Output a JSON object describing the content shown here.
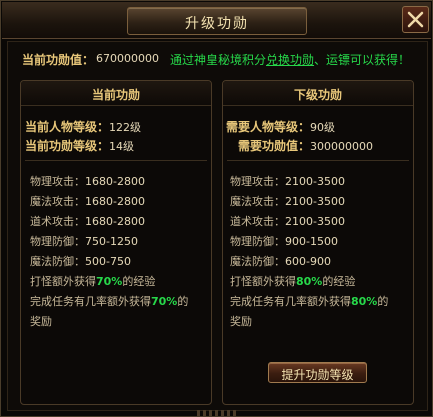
{
  "window": {
    "title": "升级功勋",
    "close_icon": "close-icon"
  },
  "info": {
    "label": "当前功勋值：",
    "value": "670000000",
    "note_prefix": "通过神皇秘境积分",
    "note_link": "兑换功勋",
    "note_suffix": "、运镖可以获得！"
  },
  "current": {
    "header": "当前功勋",
    "char_level_label": "当前人物等级：",
    "char_level_value": "122级",
    "merit_level_label": "当前功勋等级：",
    "merit_level_value": "14级",
    "stats": [
      {
        "label": "物理攻击：",
        "value": "1680-2800"
      },
      {
        "label": "魔法攻击：",
        "value": "1680-2800"
      },
      {
        "label": "道术攻击：",
        "value": "1680-2800"
      },
      {
        "label": "物理防御：",
        "value": "750-1250"
      },
      {
        "label": "魔法防御：",
        "value": "500-750"
      }
    ],
    "bonus1_pre": "打怪额外获得",
    "bonus1_pct": "70%",
    "bonus1_post": "的经验",
    "bonus2_pre": "完成任务有几率额外获得",
    "bonus2_pct": "70%",
    "bonus2_post": "的",
    "bonus2_line2": "奖励"
  },
  "next": {
    "header": "下级功勋",
    "char_level_label": "需要人物等级：",
    "char_level_value": "90级",
    "merit_label": "需要功勋值：",
    "merit_value": "300000000",
    "stats": [
      {
        "label": "物理攻击：",
        "value": "2100-3500"
      },
      {
        "label": "魔法攻击：",
        "value": "2100-3500"
      },
      {
        "label": "道术攻击：",
        "value": "2100-3500"
      },
      {
        "label": "物理防御：",
        "value": "900-1500"
      },
      {
        "label": "魔法防御：",
        "value": "600-900"
      }
    ],
    "bonus1_pre": "打怪额外获得",
    "bonus1_pct": "80%",
    "bonus1_post": "的经验",
    "bonus2_pre": "完成任务有几率额外获得",
    "bonus2_pct": "80%",
    "bonus2_post": "的",
    "bonus2_line2": "奖励"
  },
  "actions": {
    "upgrade_label": "提升功勋等级"
  },
  "colors": {
    "gold": "#e8c77a",
    "green": "#27d84a",
    "text": "#c8b99a"
  }
}
